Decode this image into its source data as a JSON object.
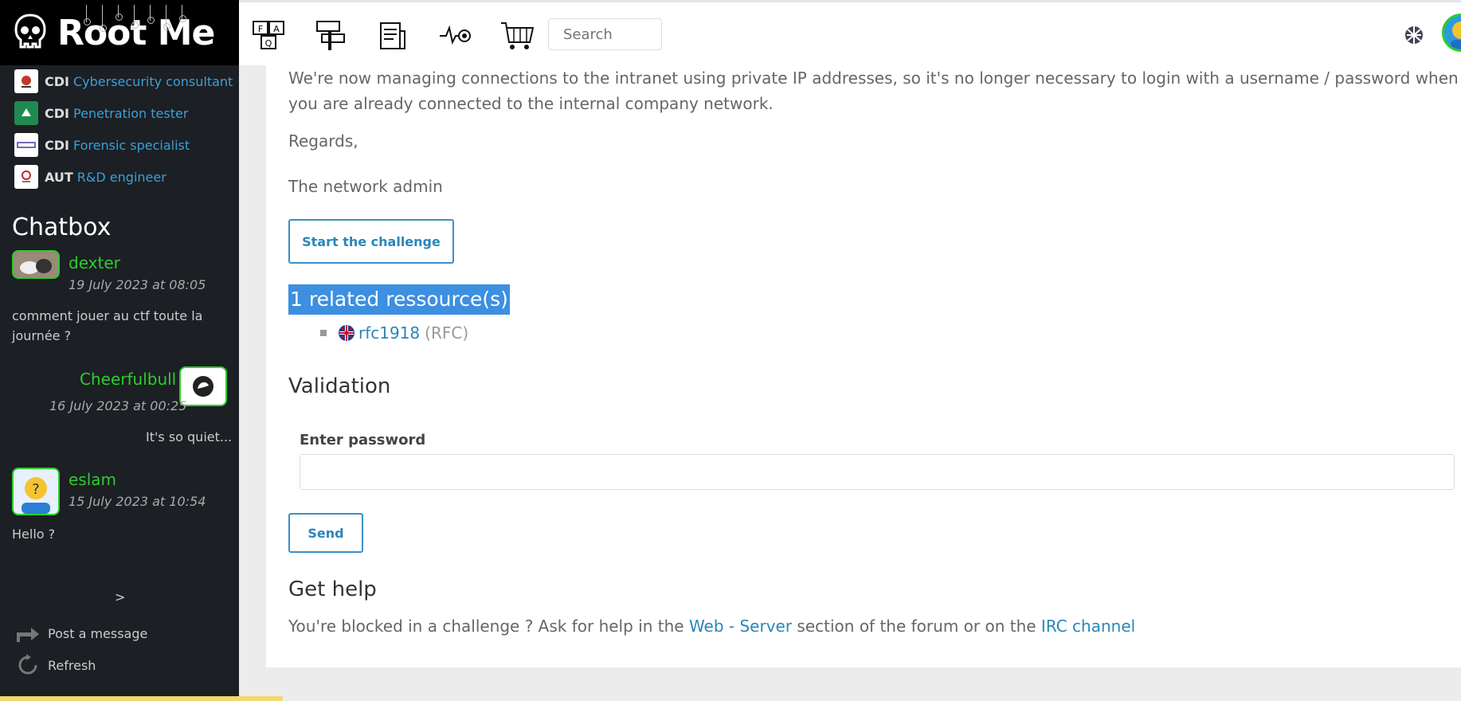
{
  "brand": {
    "name": "Root Me"
  },
  "jobs": [
    {
      "type": "CDI",
      "title": "Cybersecurity consultant",
      "logo": "company-logo-red"
    },
    {
      "type": "CDI",
      "title": "Penetration tester",
      "logo": "company-logo-green"
    },
    {
      "type": "CDI",
      "title": "Forensic specialist",
      "logo": "company-logo-text"
    },
    {
      "type": "AUT",
      "title": "R&D engineer",
      "logo": "company-logo-crest"
    }
  ],
  "chatbox": {
    "title": "Chatbox",
    "messages": [
      {
        "user": "dexter",
        "date": "19 July 2023 at 08:05",
        "text": "comment jouer au ctf toute la journée ?"
      },
      {
        "user": "Cheerfulbull",
        "date": "16 July 2023 at 00:25",
        "text": "It's so quiet..."
      },
      {
        "user": "eslam",
        "date": "15 July 2023 at 10:54",
        "text": "Hello ?"
      }
    ],
    "next_label": ">",
    "post_label": "Post a message",
    "refresh_label": "Refresh"
  },
  "topbar": {
    "icons": [
      "faq-icon",
      "signpost-icon",
      "documents-icon",
      "activity-target-icon",
      "shopping-cart-icon"
    ],
    "search_placeholder": "Search"
  },
  "content": {
    "intro": "We're now managing connections to the intranet using private IP addresses, so it's no longer necessary to login with a username / password when you are already connected to the internal company network.",
    "regards": "Regards,",
    "signature": "The network admin",
    "start_button": "Start the challenge",
    "related_title": "1 related ressource(s)",
    "related_items": [
      {
        "link": "rfc1918",
        "kind": "(RFC)"
      }
    ],
    "validation_title": "Validation",
    "password_label": "Enter password",
    "send_button": "Send",
    "help_title": "Get help",
    "help_text_1": "You're blocked in a challenge ? Ask for help in the ",
    "help_link_1": "Web - Server",
    "help_text_2": " section of the forum or on the ",
    "help_link_2": "IRC channel"
  },
  "colors": {
    "sidebar_bg": "#1c1f24",
    "link": "#2a86b9",
    "username": "#2ecc2e",
    "selection": "#3d8fe0"
  }
}
